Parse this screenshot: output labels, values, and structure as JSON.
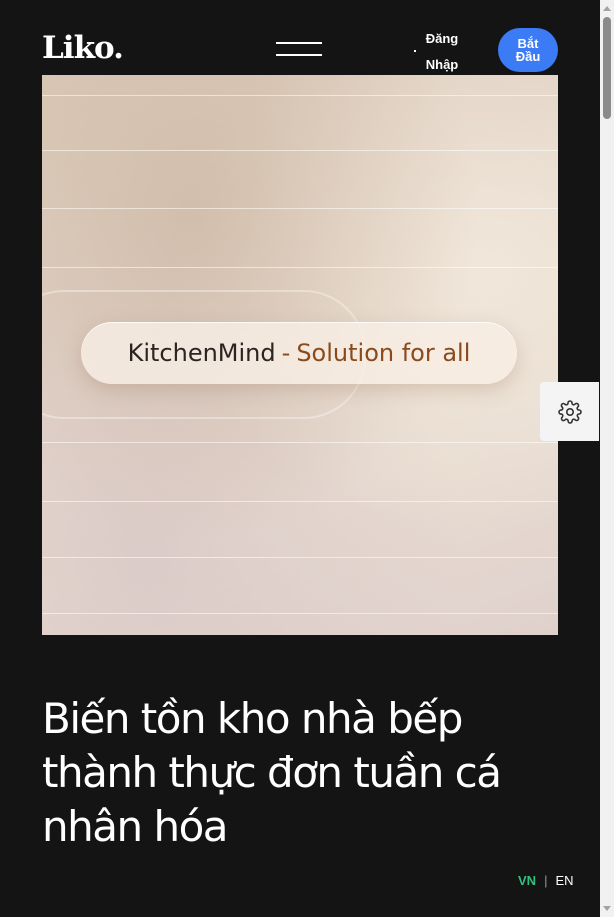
{
  "header": {
    "logo_text": "Liko.",
    "login_label": "Đăng Nhập",
    "start_label": "Bắt Đầu"
  },
  "hero": {
    "brand_text": "KitchenMind",
    "separator": "-",
    "tagline": "Solution for all"
  },
  "main": {
    "headline": "Biến tồn kho nhà bếp thành thực đơn tuần cá nhân hóa"
  },
  "language": {
    "active": "VN",
    "divider": "|",
    "other": "EN"
  },
  "colors": {
    "background": "#141414",
    "accent_button": "#3b7bf5",
    "active_language": "#2ec27e",
    "tagline": "#8a4a1c"
  },
  "icons": {
    "menu": "hamburger-icon",
    "settings": "gear-icon"
  }
}
